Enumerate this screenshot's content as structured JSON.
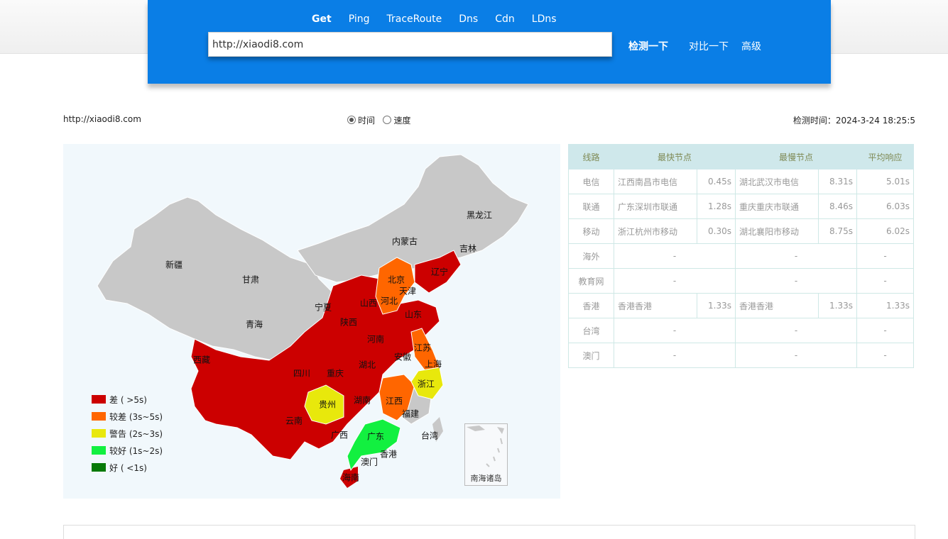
{
  "nav": {
    "tabs": [
      "Get",
      "Ping",
      "TraceRoute",
      "Dns",
      "Cdn",
      "LDns"
    ],
    "active_tab": "Get"
  },
  "search": {
    "url_value": "http://xiaodi8.com",
    "check_label": "检测一下",
    "compare_label": "对比一下",
    "advanced_label": "高级"
  },
  "info": {
    "url": "http://xiaodi8.com",
    "radio_time": "时间",
    "radio_speed": "速度",
    "radio_selected": "时间",
    "check_time": "检测时间：2024-3-24 18:25:5"
  },
  "legend": [
    {
      "label": "差 ( >5s)",
      "color": "#cc0000"
    },
    {
      "label": "较差 (3s~5s)",
      "color": "#ff6600"
    },
    {
      "label": "警告 (2s~3s)",
      "color": "#e8e80c"
    },
    {
      "label": "较好 (1s~2s)",
      "color": "#12f040"
    },
    {
      "label": "好 ( <1s)",
      "color": "#087a08"
    }
  ],
  "map": {
    "inset_label": "南海诸岛",
    "provinces": [
      {
        "name": "黑龙江",
        "color": "#c8c8c8"
      },
      {
        "name": "吉林",
        "color": "#c8c8c8"
      },
      {
        "name": "辽宁",
        "color": "#cc0000"
      },
      {
        "name": "内蒙古",
        "color": "#c8c8c8"
      },
      {
        "name": "北京",
        "color": "#ff6600"
      },
      {
        "name": "天津",
        "color": "#ff6600"
      },
      {
        "name": "河北",
        "color": "#ff6600"
      },
      {
        "name": "山西",
        "color": "#cc0000"
      },
      {
        "name": "山东",
        "color": "#cc0000"
      },
      {
        "name": "宁夏",
        "color": "#c8c8c8"
      },
      {
        "name": "新疆",
        "color": "#c8c8c8"
      },
      {
        "name": "甘肃",
        "color": "#c8c8c8"
      },
      {
        "name": "青海",
        "color": "#c8c8c8"
      },
      {
        "name": "陕西",
        "color": "#cc0000"
      },
      {
        "name": "河南",
        "color": "#cc0000"
      },
      {
        "name": "江苏",
        "color": "#ff6600"
      },
      {
        "name": "安徽",
        "color": "#cc0000"
      },
      {
        "name": "上海",
        "color": "#ff6600"
      },
      {
        "name": "西藏",
        "color": "#c8c8c8"
      },
      {
        "name": "四川",
        "color": "#cc0000"
      },
      {
        "name": "重庆",
        "color": "#cc0000"
      },
      {
        "name": "湖北",
        "color": "#cc0000"
      },
      {
        "name": "浙江",
        "color": "#e8e80c"
      },
      {
        "name": "贵州",
        "color": "#e8e80c"
      },
      {
        "name": "湖南",
        "color": "#cc0000"
      },
      {
        "name": "江西",
        "color": "#ff6600"
      },
      {
        "name": "福建",
        "color": "#c8c8c8"
      },
      {
        "name": "云南",
        "color": "#cc0000"
      },
      {
        "name": "广西",
        "color": "#cc0000"
      },
      {
        "name": "广东",
        "color": "#12f040"
      },
      {
        "name": "台湾",
        "color": "#c8c8c8"
      },
      {
        "name": "香港",
        "color": "#12f040"
      },
      {
        "name": "澳门",
        "color": "#12f040"
      },
      {
        "name": "海南",
        "color": "#cc0000"
      }
    ]
  },
  "table": {
    "headers": [
      "线路",
      "最快节点",
      "最慢节点",
      "平均响应"
    ],
    "rows": [
      {
        "line": "电信",
        "fast_name": "江西南昌市电信",
        "fast_time": "0.45s",
        "slow_name": "湖北武汉市电信",
        "slow_time": "8.31s",
        "avg": "5.01s"
      },
      {
        "line": "联通",
        "fast_name": "广东深圳市联通",
        "fast_time": "1.28s",
        "slow_name": "重庆重庆市联通",
        "slow_time": "8.46s",
        "avg": "6.03s"
      },
      {
        "line": "移动",
        "fast_name": "浙江杭州市移动",
        "fast_time": "0.30s",
        "slow_name": "湖北襄阳市移动",
        "slow_time": "8.75s",
        "avg": "6.02s"
      },
      {
        "line": "海外",
        "fast": "-",
        "slow": "-",
        "avg": "-"
      },
      {
        "line": "教育网",
        "fast": "-",
        "slow": "-",
        "avg": "-"
      },
      {
        "line": "香港",
        "fast_name": "香港香港",
        "fast_time": "1.33s",
        "slow_name": "香港香港",
        "slow_time": "1.33s",
        "avg": "1.33s"
      },
      {
        "line": "台湾",
        "fast": "-",
        "slow": "-",
        "avg": "-"
      },
      {
        "line": "澳门",
        "fast": "-",
        "slow": "-",
        "avg": "-"
      }
    ]
  }
}
